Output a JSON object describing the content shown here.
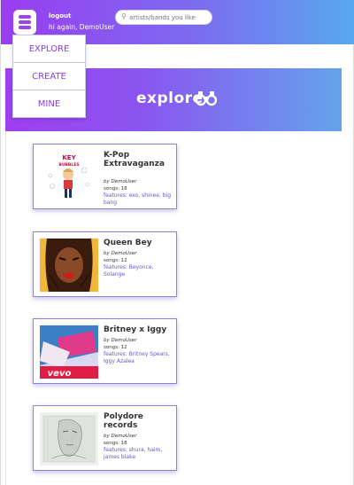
{
  "header": {
    "logout_label": "logout",
    "greeting_prefix": "hi again,",
    "username": "DemoUser",
    "search_placeholder": "artists/bands you like"
  },
  "menu": {
    "items": [
      {
        "label": "EXPLORE"
      },
      {
        "label": "CREATE"
      },
      {
        "label": "MINE"
      }
    ]
  },
  "banner": {
    "title": "explore"
  },
  "playlists": [
    {
      "title": "K-Pop Extravaganza",
      "by": "by DemoUser",
      "songs": "songs: 18",
      "features": "features: exo, shinee, big bang",
      "thumb_text": [
        "KEY",
        "BUBBLES"
      ]
    },
    {
      "title": "Queen Bey",
      "by": "by DemoUser",
      "songs": "songs: 12",
      "features": "features: Beyonce, Solange"
    },
    {
      "title": "Britney x Iggy",
      "by": "by DemoUser",
      "songs": "songs: 12",
      "features": "features: Britney Spears, Iggy Azalea",
      "thumb_text": [
        "vevo"
      ]
    },
    {
      "title": "Polydore records",
      "by": "by DemoUser",
      "songs": "songs: 18",
      "features": "features: shura, haim, james blake"
    }
  ],
  "colors": {
    "accent": "#8a3dea",
    "feature_text": "#6a52d8"
  }
}
